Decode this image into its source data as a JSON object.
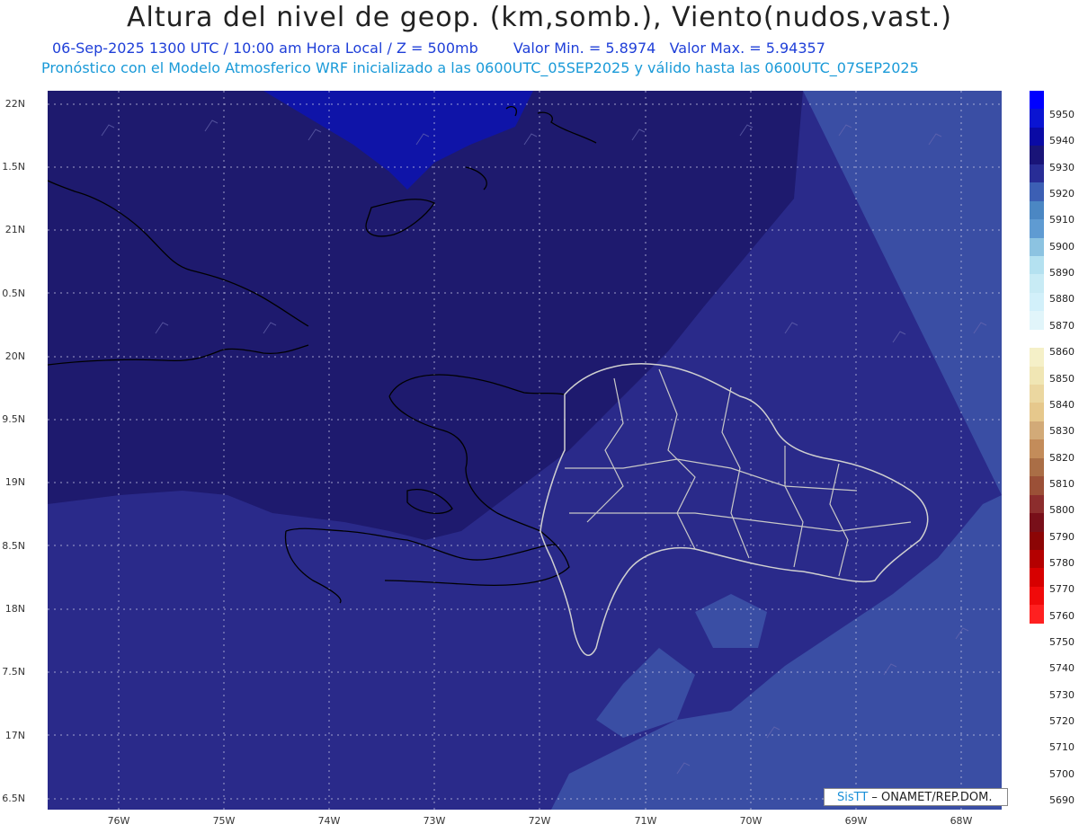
{
  "title": "Altura del nivel de geop. (km,somb.), Viento(nudos,vast.)",
  "subtitle1": {
    "datetime": "06-Sep-2025  1300 UTC / 10:00 am Hora Local / Z = 500mb",
    "min": "Valor Min. = 5.8974",
    "max": "Valor Max. = 5.94357"
  },
  "subtitle2": "Pronóstico con el Modelo Atmosferico WRF inicializado a las 0600UTC_05SEP2025 y válido hasta las  0600UTC_07SEP2025",
  "lat_labels": [
    "22N",
    "1.5N",
    "21N",
    "0.5N",
    "20N",
    "9.5N",
    "19N",
    "8.5N",
    "18N",
    "7.5N",
    "17N",
    "6.5N"
  ],
  "lon_labels": [
    "76W",
    "75W",
    "74W",
    "73W",
    "72W",
    "71W",
    "70W",
    "69W",
    "68W"
  ],
  "colorbar": {
    "labels": [
      "5950",
      "5940",
      "5930",
      "5920",
      "5910",
      "5900",
      "5890",
      "5880",
      "5870",
      "5860",
      "5850",
      "5840",
      "5830",
      "5820",
      "5810",
      "5800",
      "5790",
      "5780",
      "5770",
      "5760",
      "5750",
      "5740",
      "5730",
      "5720",
      "5710",
      "5700",
      "5690"
    ],
    "colors": [
      "#0000ff",
      "#0a14d2",
      "#0a0aa5",
      "#191478",
      "#282d96",
      "#3c5fb4",
      "#4b87c3",
      "#5f9bd2",
      "#8cc3e1",
      "#b4e1f0",
      "#c8ebf5",
      "#d2f0fa",
      "#e1f5fa",
      "#ffffff",
      "#f5f0c8",
      "#f0e6b4",
      "#ebd7a0",
      "#e6c88c",
      "#d2aa78",
      "#c38c5a",
      "#aa6e46",
      "#9b5037",
      "#8c2d2d",
      "#780f19",
      "#8c0505",
      "#b40000",
      "#d70000",
      "#f00a0a",
      "#ff2020"
    ]
  },
  "colors": {
    "field_high": "#1e1a6e",
    "field_mid": "#2a2a8a",
    "field_low": "#3a4ea4",
    "field_peak": "#0f14a8",
    "coast": "#000000",
    "provinces": "#c8c8c8"
  },
  "credit": {
    "brand": "SisTT",
    "text": " – ONAMET/REP.DOM."
  }
}
